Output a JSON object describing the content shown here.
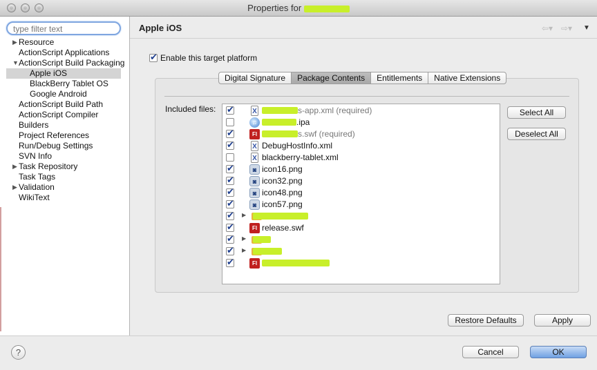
{
  "window": {
    "title_prefix": "Properties for"
  },
  "sidebar": {
    "filter_placeholder": "type filter text",
    "items": [
      {
        "label": "Resource",
        "expandable": true,
        "expanded": false,
        "level": 0
      },
      {
        "label": "ActionScript Applications",
        "expandable": false,
        "level": 0
      },
      {
        "label": "ActionScript Build Packaging",
        "expandable": true,
        "expanded": true,
        "level": 0
      },
      {
        "label": "Apple iOS",
        "expandable": false,
        "level": 1,
        "selected": true
      },
      {
        "label": "BlackBerry Tablet OS",
        "expandable": false,
        "level": 1
      },
      {
        "label": "Google Android",
        "expandable": false,
        "level": 1
      },
      {
        "label": "ActionScript Build Path",
        "expandable": false,
        "level": 0
      },
      {
        "label": "ActionScript Compiler",
        "expandable": false,
        "level": 0
      },
      {
        "label": "Builders",
        "expandable": false,
        "level": 0
      },
      {
        "label": "Project References",
        "expandable": false,
        "level": 0
      },
      {
        "label": "Run/Debug Settings",
        "expandable": false,
        "level": 0
      },
      {
        "label": "SVN Info",
        "expandable": false,
        "level": 0
      },
      {
        "label": "Task Repository",
        "expandable": true,
        "expanded": false,
        "level": 0
      },
      {
        "label": "Task Tags",
        "expandable": false,
        "level": 0
      },
      {
        "label": "Validation",
        "expandable": true,
        "expanded": false,
        "level": 0
      },
      {
        "label": "WikiText",
        "expandable": false,
        "level": 0
      }
    ]
  },
  "header": {
    "title": "Apple iOS"
  },
  "main": {
    "enable_label": "Enable this target platform",
    "enable_checked": true,
    "tabs": [
      {
        "label": "Digital Signature",
        "active": false
      },
      {
        "label": "Package Contents",
        "active": true
      },
      {
        "label": "Entitlements",
        "active": false
      },
      {
        "label": "Native Extensions",
        "active": false
      }
    ],
    "included_label": "Included files:",
    "files": [
      {
        "name": "s-app.xml (required)",
        "icon": "xml-file-icon",
        "checked": true,
        "dim": true,
        "redacted": true,
        "expandable": false
      },
      {
        "name": ".ipa",
        "icon": "ipa-file-icon",
        "checked": false,
        "dim": false,
        "redacted": true,
        "expandable": false
      },
      {
        "name": "s.swf (required)",
        "icon": "flash-file-icon",
        "checked": true,
        "dim": true,
        "redacted": true,
        "expandable": false
      },
      {
        "name": "DebugHostInfo.xml",
        "icon": "xml-file-icon",
        "checked": true,
        "dim": false,
        "redacted": false,
        "expandable": false
      },
      {
        "name": "blackberry-tablet.xml",
        "icon": "xml-file-icon",
        "checked": false,
        "dim": false,
        "redacted": false,
        "expandable": false
      },
      {
        "name": "icon16.png",
        "icon": "png-file-icon",
        "checked": true,
        "dim": false,
        "redacted": false,
        "expandable": false
      },
      {
        "name": "icon32.png",
        "icon": "png-file-icon",
        "checked": true,
        "dim": false,
        "redacted": false,
        "expandable": false
      },
      {
        "name": "icon48.png",
        "icon": "png-file-icon",
        "checked": true,
        "dim": false,
        "redacted": false,
        "expandable": false
      },
      {
        "name": "icon57.png",
        "icon": "png-file-icon",
        "checked": true,
        "dim": false,
        "redacted": false,
        "expandable": false
      },
      {
        "name": "",
        "icon": "folder-icon",
        "checked": true,
        "dim": false,
        "redacted": true,
        "expandable": true
      },
      {
        "name": "release.swf",
        "icon": "flash-file-icon",
        "checked": true,
        "dim": false,
        "redacted": false,
        "expandable": false
      },
      {
        "name": "",
        "icon": "folder-icon",
        "checked": true,
        "dim": false,
        "redacted": true,
        "expandable": true
      },
      {
        "name": "",
        "icon": "folder-icon",
        "checked": true,
        "dim": false,
        "redacted": true,
        "expandable": true
      },
      {
        "name": "",
        "icon": "flash-file-icon",
        "checked": true,
        "dim": false,
        "redacted": true,
        "expandable": false
      }
    ],
    "select_all_label": "Select All",
    "deselect_all_label": "Deselect All",
    "restore_defaults_label": "Restore Defaults",
    "apply_label": "Apply"
  },
  "footer": {
    "help_label": "?",
    "cancel_label": "Cancel",
    "ok_label": "OK"
  },
  "colors": {
    "selection": "#d4d4d4",
    "default_button": "#6fa0e2",
    "redaction": "#c8ef2a"
  }
}
